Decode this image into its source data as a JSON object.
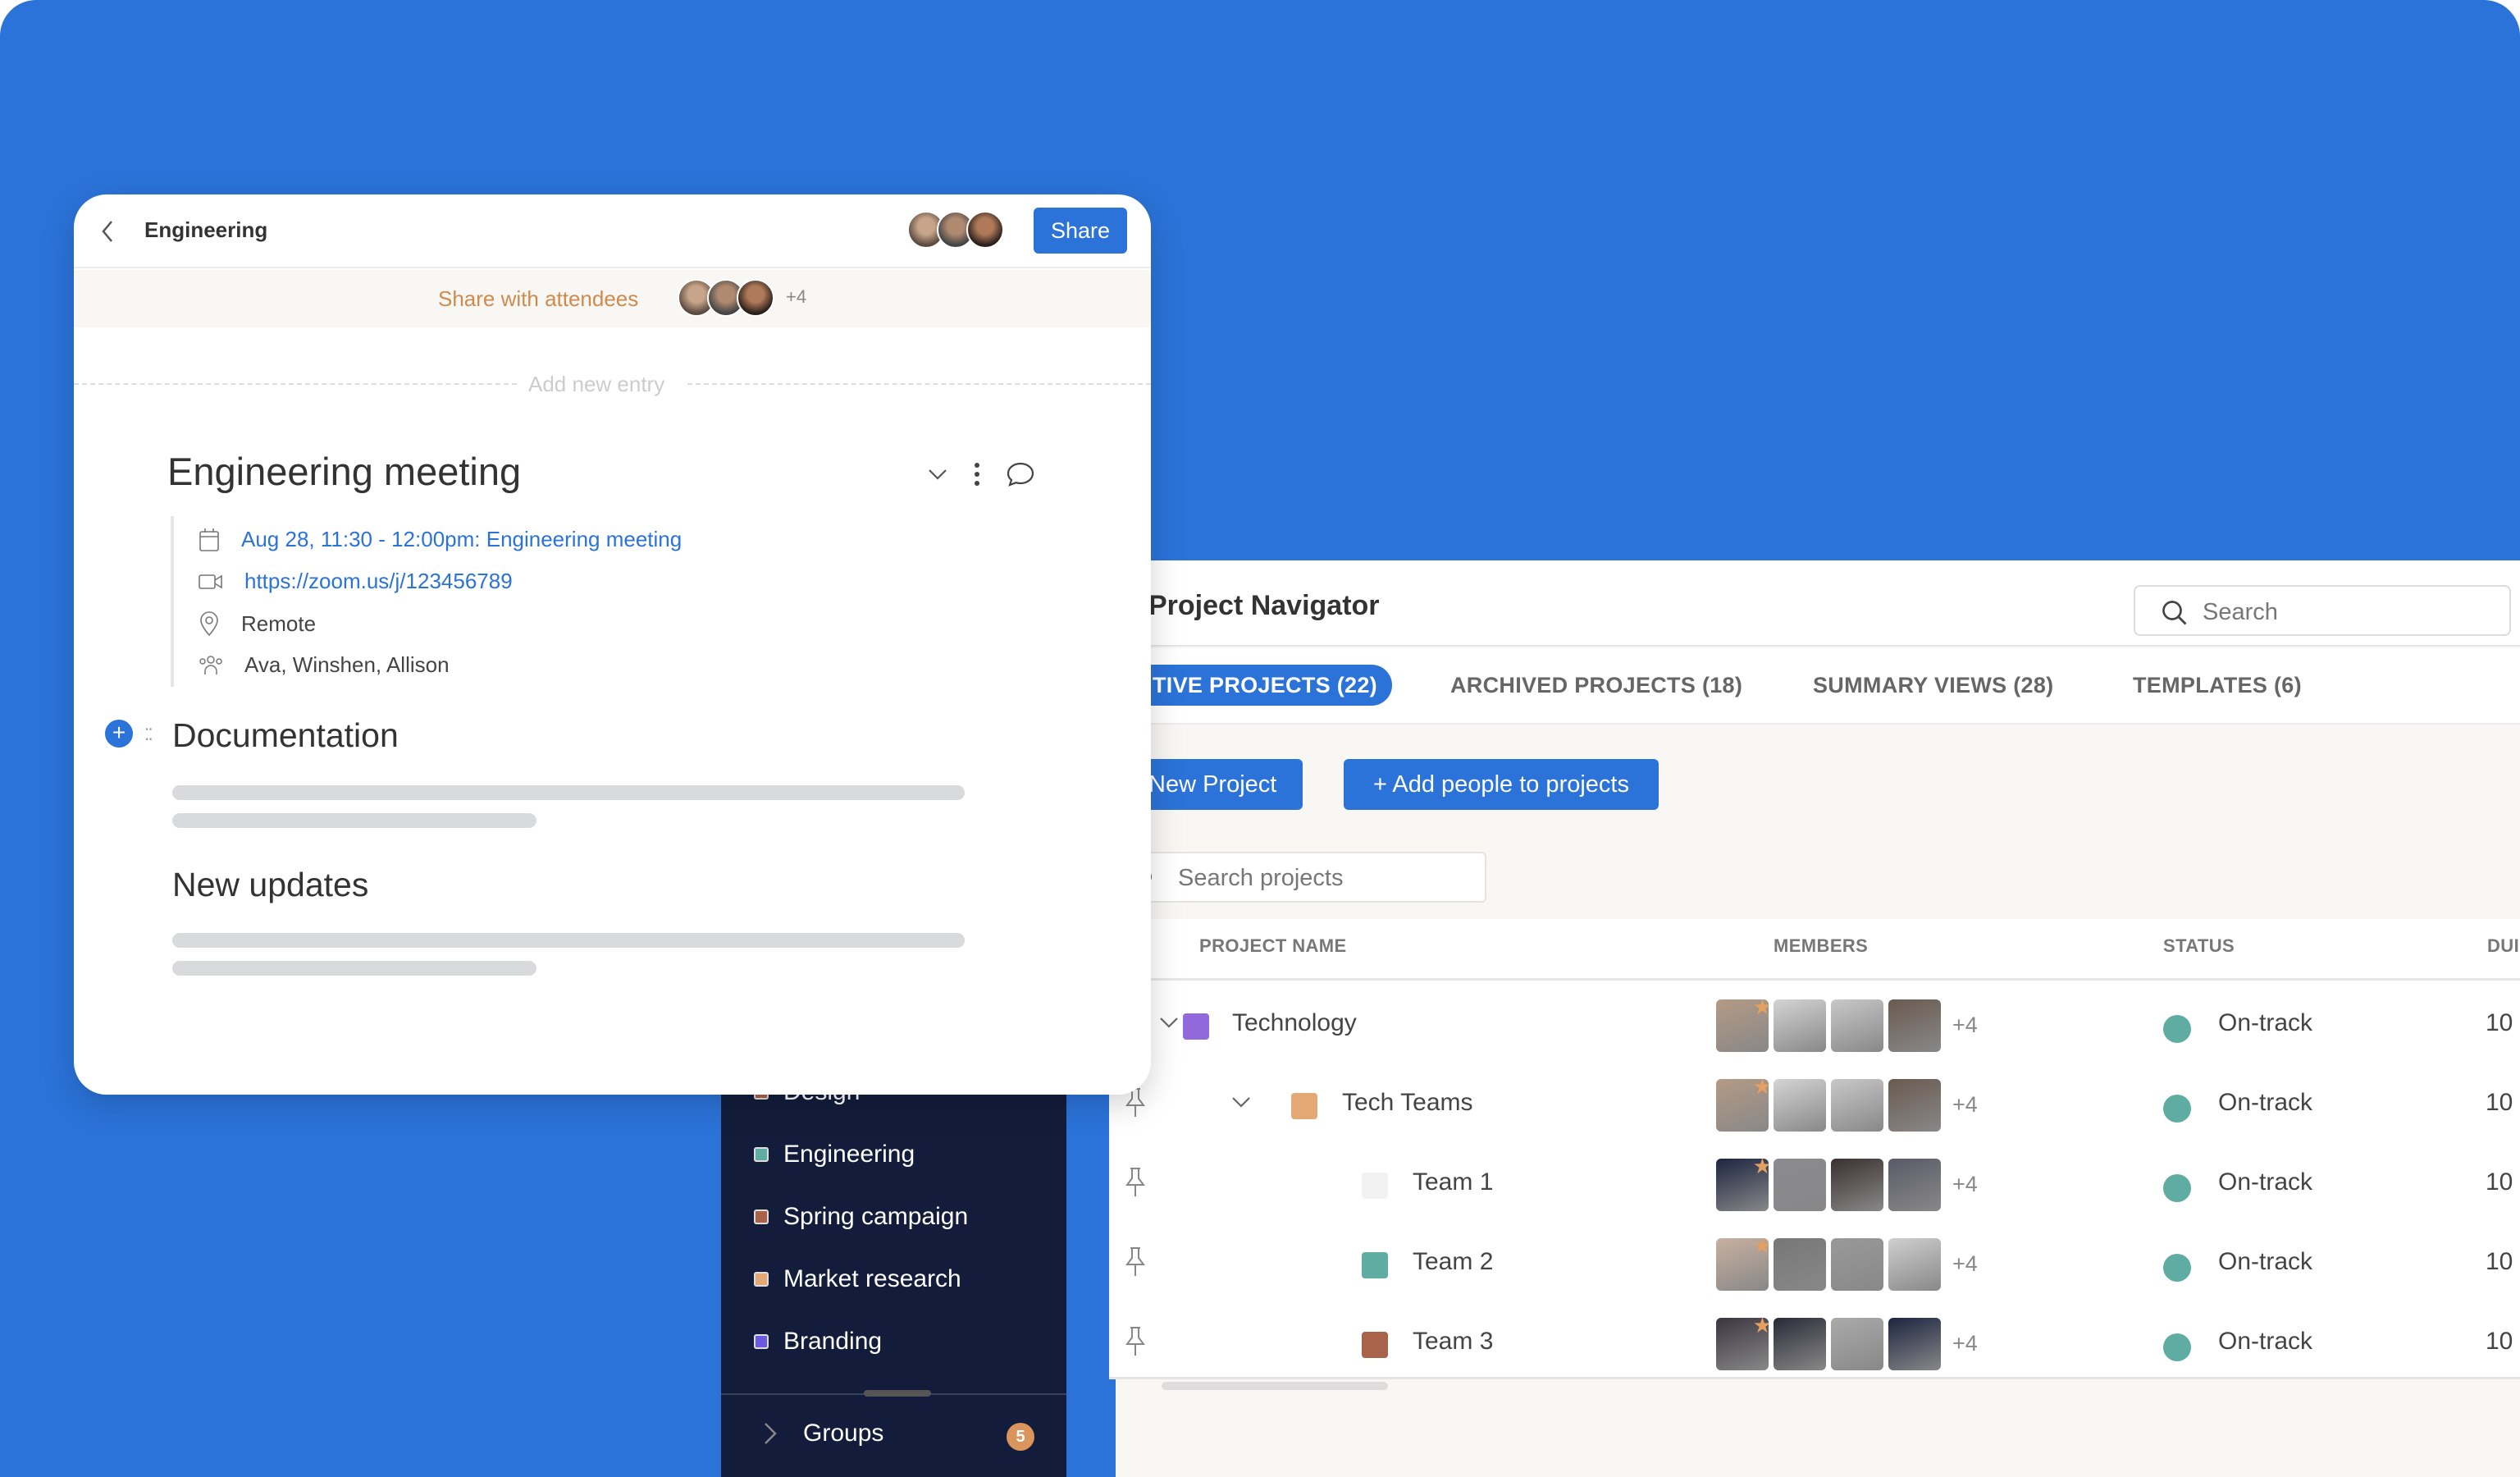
{
  "card": {
    "breadcrumb": "Engineering",
    "share_label": "Share",
    "share_with_attendees": "Share with attendees",
    "attendees_more": "+4",
    "add_new_entry": "Add new entry",
    "meeting_title": "Engineering meeting",
    "meeting": {
      "datetime": "Aug 28, 11:30 - 12:00pm: Engineering meeting",
      "zoom_link": "https://zoom.us/j/123456789",
      "location": "Remote",
      "attendees": "Ava, Winshen, Allison"
    },
    "section_documentation": "Documentation",
    "section_new_updates": "New updates"
  },
  "navigator": {
    "title": "Project Navigator",
    "search_placeholder": "Search",
    "tabs": [
      {
        "label": "TIVE PROJECTS (22)",
        "active": true
      },
      {
        "label": "ARCHIVED PROJECTS (18)",
        "active": false
      },
      {
        "label": "SUMMARY VIEWS (28)",
        "active": false
      },
      {
        "label": "TEMPLATES (6)",
        "active": false
      }
    ],
    "new_project_label": "New Project",
    "add_people_label": "+ Add people to projects",
    "search_projects_placeholder": "Search projects",
    "columns": [
      "PROJECT NAME",
      "MEMBERS",
      "STATUS",
      "DUI"
    ],
    "rows": [
      {
        "name": "Technology",
        "color": "#9169dc",
        "members_more": "+4",
        "status": "On-track",
        "due": "10",
        "expandable": true,
        "pinned": false
      },
      {
        "name": "Tech Teams",
        "color": "#e3a873",
        "members_more": "+4",
        "status": "On-track",
        "due": "10",
        "expandable": true,
        "pinned": true
      },
      {
        "name": "Team 1",
        "color": "#f2f2f2",
        "members_more": "+4",
        "status": "On-track",
        "due": "10",
        "expandable": false,
        "pinned": true
      },
      {
        "name": "Team 2",
        "color": "#5fada2",
        "members_more": "+4",
        "status": "On-track",
        "due": "10",
        "expandable": false,
        "pinned": true
      },
      {
        "name": "Team 3",
        "color": "#a9634a",
        "members_more": "+4",
        "status": "On-track",
        "due": "10",
        "expandable": false,
        "pinned": true
      }
    ],
    "status_color": "#5fada2"
  },
  "sidebar": {
    "items": [
      {
        "label": "Design",
        "color": "#a9634a"
      },
      {
        "label": "Engineering",
        "color": "#5fada2"
      },
      {
        "label": "Spring campaign",
        "color": "#a9634a"
      },
      {
        "label": "Market research",
        "color": "#e3a873"
      },
      {
        "label": "Branding",
        "color": "#6a5ae0"
      }
    ],
    "groups_label": "Groups",
    "groups_count": "5"
  }
}
